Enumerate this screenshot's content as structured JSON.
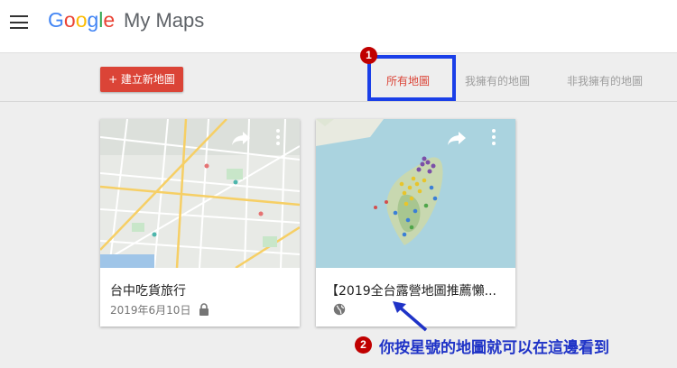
{
  "header": {
    "logo_letters": [
      "G",
      "o",
      "o",
      "g",
      "l",
      "e"
    ],
    "product_name": "My Maps"
  },
  "toolbar": {
    "create_button": "+ 建立新地圖",
    "tabs": [
      {
        "label": "所有地圖",
        "active": true
      },
      {
        "label": "我擁有的地圖",
        "active": false
      },
      {
        "label": "非我擁有的地圖",
        "active": false
      }
    ]
  },
  "maps": [
    {
      "title": "台中吃貨旅行",
      "date": "2019年6月10日",
      "visibility_icon": "lock-icon"
    },
    {
      "title": "【2019全台露營地圖推薦懶...",
      "date": "",
      "visibility_icon": "globe-icon"
    }
  ],
  "annotations": {
    "badge_1": "1",
    "badge_2": "2",
    "note": "你按星號的地圖就可以在這邊看到"
  },
  "colors": {
    "accent_red": "#db4437",
    "annotation_blue": "#1a3fe8",
    "badge_red": "#c00000"
  }
}
